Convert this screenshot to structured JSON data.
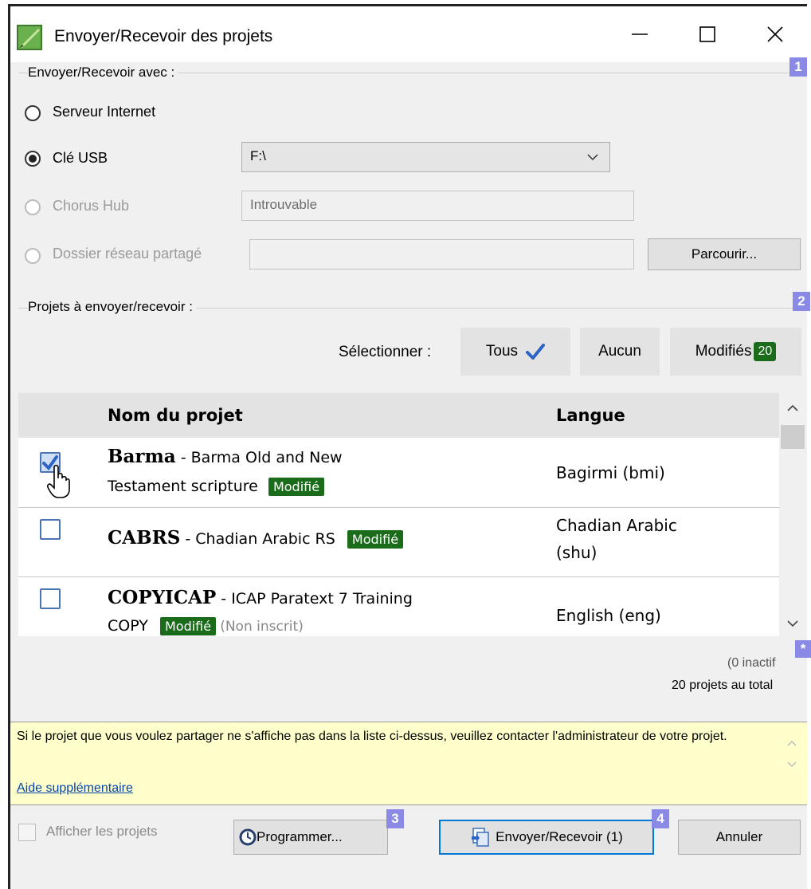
{
  "window": {
    "title": "Envoyer/Recevoir des projets",
    "minimize_glyph": "—",
    "maximize_glyph": "☐",
    "close_glyph": "✕"
  },
  "send_receive_group": {
    "label": "Envoyer/Recevoir avec :",
    "badge": "1",
    "options": {
      "internet": "Serveur Internet",
      "usb": "Clé USB",
      "chorus": "Chorus Hub",
      "shared": "Dossier réseau partagé"
    },
    "usb_value": "F:\\",
    "chorus_value": "Introuvable",
    "shared_value": "",
    "browse_label": "Parcourir..."
  },
  "projects_group": {
    "label": "Projets à envoyer/recevoir :",
    "badge": "2",
    "select_label": "Sélectionner :",
    "all_label": "Tous",
    "none_label": "Aucun",
    "modified_label": "Modifiés",
    "modified_count": "20",
    "columns": {
      "name": "Nom du projet",
      "language": "Langue"
    },
    "rows": [
      {
        "name": "Barma",
        "sep": " - ",
        "desc1": "Barma Old and New",
        "desc2": "Testament scripture",
        "tag": "Modifié",
        "extra": "",
        "lang1": "Bagirmi (bmi)",
        "lang2": "",
        "checked": true
      },
      {
        "name": "CABRS",
        "sep": " - ",
        "desc1": "Chadian Arabic RS",
        "desc2": "",
        "tag": "Modifié",
        "extra": "",
        "lang1": "Chadian Arabic",
        "lang2": "(shu)",
        "checked": false
      },
      {
        "name": "COPYICAP",
        "sep": " - ",
        "desc1": "ICAP Paratext 7 Training",
        "desc2": "COPY",
        "tag": "Modifié",
        "extra": "(Non inscrit)",
        "lang1": "English (eng)",
        "lang2": "",
        "checked": false
      }
    ]
  },
  "footer_counts": {
    "badge": "*",
    "inactive": "(0 inactif",
    "total": "20 projets au total"
  },
  "info": {
    "text": "Si le projet que vous voulez partager ne s'affiche pas dans la liste ci-dessus, veuillez contacter l'administrateur de votre projet.",
    "link": "Aide supplémentaire"
  },
  "bottom": {
    "show_projects_label": "Afficher les projets",
    "schedule_label": "Programmer...",
    "schedule_badge": "3",
    "send_receive_label": "Envoyer/Recevoir (1)",
    "send_receive_badge": "4",
    "cancel_label": "Annuler"
  },
  "colors": {
    "green_badge": "#1a6b1a",
    "blue_badge": "#8a8ae6",
    "checkmark": "#2c63c4",
    "info_bg": "#ffffcc",
    "link": "#0645ad"
  },
  "icons": [
    "app-icon",
    "minimize-icon",
    "maximize-icon",
    "close-icon",
    "checkmark-icon",
    "chevron-down-icon",
    "hand-cursor-icon",
    "scroll-up-icon",
    "scroll-down-icon",
    "clock-icon",
    "send-receive-icon"
  ]
}
